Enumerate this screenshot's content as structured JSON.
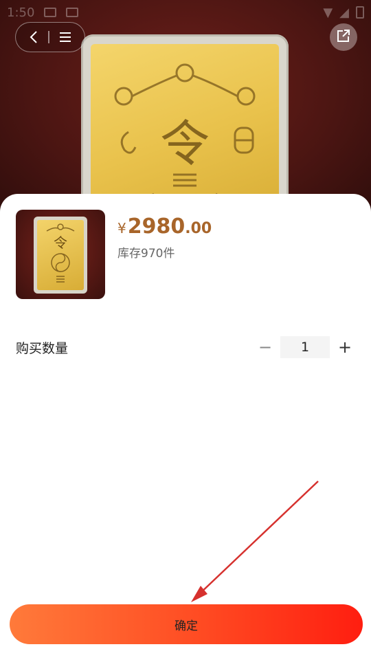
{
  "status_bar": {
    "time": "1:50"
  },
  "product": {
    "price_currency": "¥",
    "price_integer": "2980",
    "price_decimal": ".00",
    "stock_text": "库存970件"
  },
  "quantity": {
    "label": "购买数量",
    "minus": "−",
    "value": "1",
    "plus": "+"
  },
  "actions": {
    "confirm_label": "确定"
  },
  "colors": {
    "price": "#a8652a",
    "confirm_gradient_start": "#ff7a3a",
    "confirm_gradient_end": "#ff1e10",
    "annotation_arrow": "#d6312e"
  }
}
